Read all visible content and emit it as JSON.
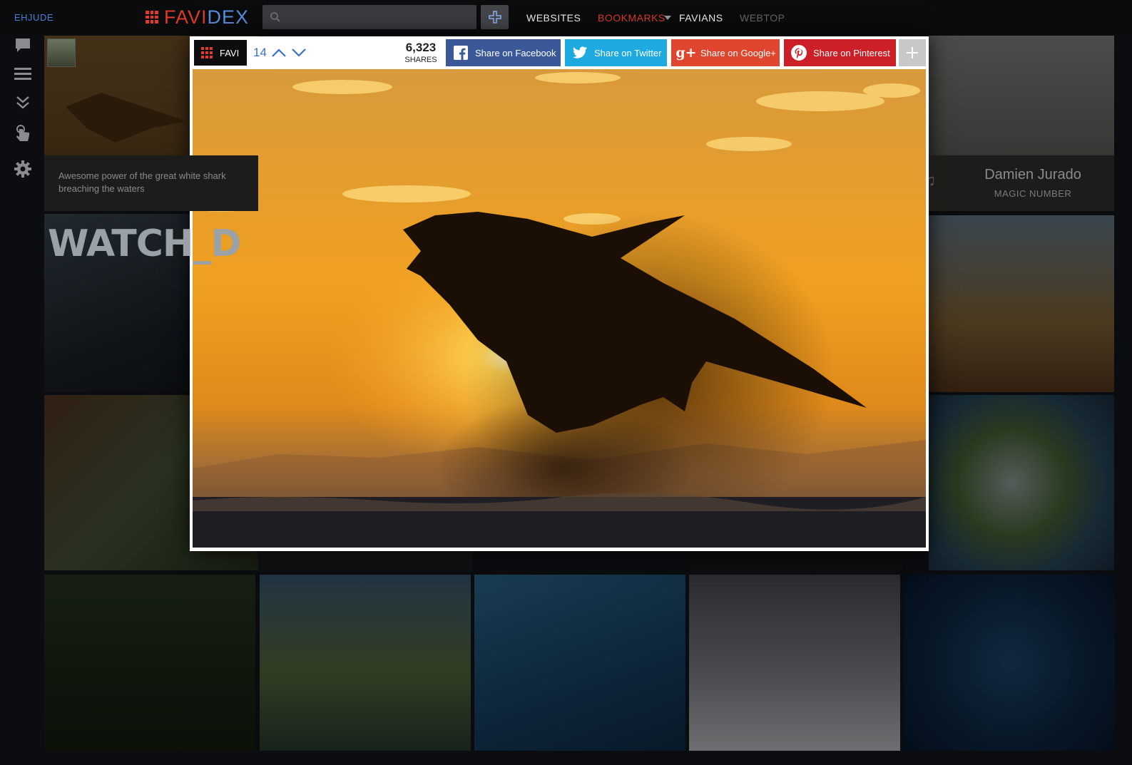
{
  "topbar": {
    "username": "EHJUDE",
    "logo_part1": "FAVI",
    "logo_part2": "DEX",
    "search_placeholder": "",
    "nav": [
      {
        "label": "WEBSITES"
      },
      {
        "label": "BOOKMARKS"
      },
      {
        "label": "FAVIANS"
      },
      {
        "label": "WEBTOP"
      }
    ]
  },
  "sidebar": {
    "icons": [
      "chat-icon",
      "menu-icon",
      "double-chevron-down-icon",
      "touch-icon",
      "gear-icon"
    ]
  },
  "tiles": {
    "shark_caption": "Awesome power of the great white shark breaching the waters",
    "watch_text": "WATCH_D",
    "music_artist": "Damien Jurado",
    "music_album": "MAGIC NUMBER"
  },
  "modal": {
    "favi_label": "FAVI",
    "score": "14",
    "shares_count": "6,323",
    "shares_label": "SHARES",
    "share_buttons": [
      {
        "label": "Share on Facebook",
        "color": "#3b5999"
      },
      {
        "label": "Share on Twitter",
        "color": "#1fa9e1"
      },
      {
        "label": "Share on Google+",
        "color": "#e0462e"
      },
      {
        "label": "Share on Pinterest",
        "color": "#cc1f27"
      }
    ]
  },
  "colors": {
    "accent_red": "#e03a2a",
    "accent_blue": "#5a8fe0"
  }
}
